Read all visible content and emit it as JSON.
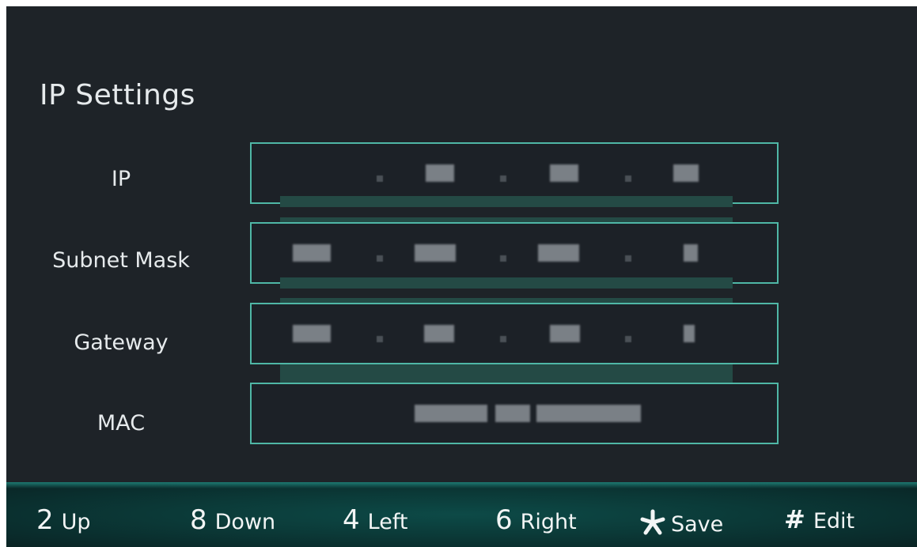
{
  "page": {
    "title": "IP Settings"
  },
  "rows": [
    {
      "label": "IP",
      "value": "▒▒▒.▒▒.▒▒.▒▒"
    },
    {
      "label": "Subnet Mask",
      "value": "▒▒▒.▒▒▒.▒▒▒.▒"
    },
    {
      "label": "Gateway",
      "value": "▒▒▒.▒▒.▒▒.▒"
    },
    {
      "label": "MAC",
      "value": "▒▒▒▒▒▒▒▒▒▒▒▒"
    }
  ],
  "footer": {
    "hints": [
      {
        "key": "2",
        "label": "Up"
      },
      {
        "key": "8",
        "label": "Down"
      },
      {
        "key": "4",
        "label": "Left"
      },
      {
        "key": "6",
        "label": "Right"
      },
      {
        "key": "★",
        "label": "Save",
        "icon": "star-icon"
      },
      {
        "key": "#",
        "label": "Edit",
        "icon": "hash-icon"
      }
    ]
  },
  "colors": {
    "background": "#1e2328",
    "field_border": "#4fb7a6",
    "divider": "#244a45",
    "footer": "#0b3a38",
    "text": "#e6eaec"
  }
}
